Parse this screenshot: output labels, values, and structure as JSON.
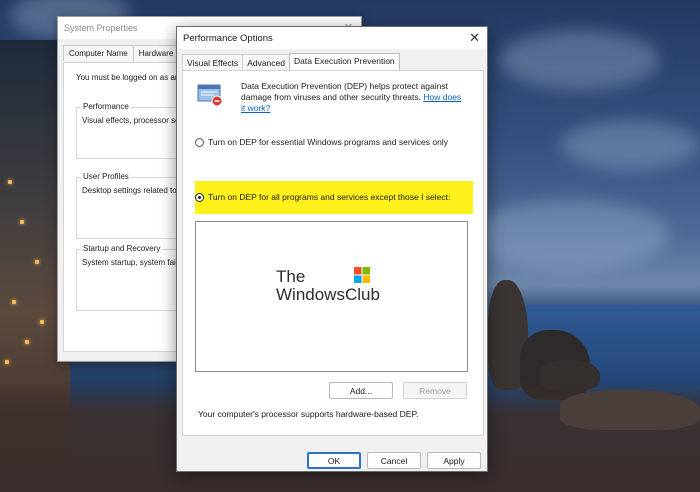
{
  "background_window": {
    "title": "System Properties",
    "tabs": [
      "Computer Name",
      "Hardware"
    ],
    "note": "You must be logged on as ar",
    "groups": [
      {
        "legend": "Performance",
        "desc": "Visual effects, processor sc"
      },
      {
        "legend": "User Profiles",
        "desc": "Desktop settings related to"
      },
      {
        "legend": "Startup and Recovery",
        "desc": "System startup, system failu"
      }
    ]
  },
  "dialog": {
    "title": "Performance Options",
    "close_glyph": "✕",
    "tabs": [
      "Visual Effects",
      "Advanced",
      "Data Execution Prevention"
    ],
    "active_tab": "Data Execution Prevention",
    "description": "Data Execution Prevention (DEP) helps protect against damage from viruses and other security threats.",
    "link": "How does it work?",
    "options": [
      {
        "label": "Turn on DEP for essential Windows programs and services only",
        "selected": false
      },
      {
        "label": "Turn on DEP for all programs and services except those I select:",
        "selected": true
      }
    ],
    "watermark": {
      "line1": "The",
      "line2": "WindowsClub"
    },
    "buttons": {
      "add": "Add...",
      "remove": "Remove",
      "ok": "OK",
      "cancel": "Cancel",
      "apply": "Apply"
    },
    "footnote": "Your computer's processor supports hardware-based DEP."
  },
  "colors": {
    "highlight": "#fff21c",
    "link": "#0a62c6",
    "accent": "#2b6fcf"
  },
  "icons": [
    "shield-icon",
    "close-icon",
    "windows-logo-icon"
  ]
}
